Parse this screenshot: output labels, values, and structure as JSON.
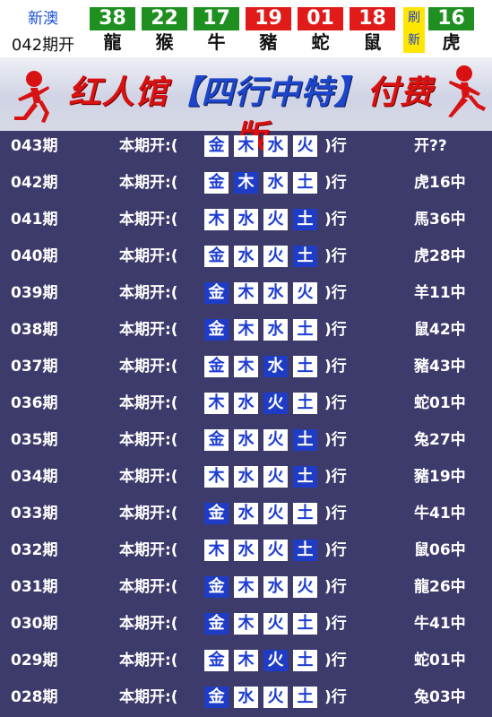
{
  "header": {
    "region": "新澳",
    "period": "042期开",
    "balls": [
      {
        "number": "38",
        "zodiac": "龍",
        "color": "green"
      },
      {
        "number": "22",
        "zodiac": "猴",
        "color": "green"
      },
      {
        "number": "17",
        "zodiac": "牛",
        "color": "green"
      },
      {
        "number": "19",
        "zodiac": "豬",
        "color": "red"
      },
      {
        "number": "01",
        "zodiac": "蛇",
        "color": "red"
      },
      {
        "number": "18",
        "zodiac": "鼠",
        "color": "red"
      }
    ],
    "refresh_label": "刷新",
    "special_ball": {
      "number": "16",
      "zodiac": "虎",
      "color": "green"
    }
  },
  "banner": {
    "title_a": "红人馆",
    "title_b": "【四行中特】",
    "title_c": "付费版"
  },
  "row_labels": {
    "prefix": "本期开:(",
    "suffix": ")行"
  },
  "rows": [
    {
      "issue": "043期",
      "elements": [
        "金",
        "木",
        "水",
        "火"
      ],
      "hit": -1,
      "result": "开??"
    },
    {
      "issue": "042期",
      "elements": [
        "金",
        "木",
        "水",
        "土"
      ],
      "hit": 1,
      "result": "虎16中"
    },
    {
      "issue": "041期",
      "elements": [
        "木",
        "水",
        "火",
        "土"
      ],
      "hit": 3,
      "result": "馬36中"
    },
    {
      "issue": "040期",
      "elements": [
        "金",
        "水",
        "火",
        "土"
      ],
      "hit": 3,
      "result": "虎28中"
    },
    {
      "issue": "039期",
      "elements": [
        "金",
        "木",
        "水",
        "火"
      ],
      "hit": 0,
      "result": "羊11中"
    },
    {
      "issue": "038期",
      "elements": [
        "金",
        "木",
        "水",
        "土"
      ],
      "hit": 0,
      "result": "鼠42中"
    },
    {
      "issue": "037期",
      "elements": [
        "金",
        "木",
        "水",
        "土"
      ],
      "hit": 2,
      "result": "豬43中"
    },
    {
      "issue": "036期",
      "elements": [
        "木",
        "水",
        "火",
        "土"
      ],
      "hit": 2,
      "result": "蛇01中"
    },
    {
      "issue": "035期",
      "elements": [
        "金",
        "水",
        "火",
        "土"
      ],
      "hit": 3,
      "result": "兔27中"
    },
    {
      "issue": "034期",
      "elements": [
        "木",
        "水",
        "火",
        "土"
      ],
      "hit": 3,
      "result": "豬19中"
    },
    {
      "issue": "033期",
      "elements": [
        "金",
        "水",
        "火",
        "土"
      ],
      "hit": 0,
      "result": "牛41中"
    },
    {
      "issue": "032期",
      "elements": [
        "木",
        "水",
        "火",
        "土"
      ],
      "hit": 3,
      "result": "鼠06中"
    },
    {
      "issue": "031期",
      "elements": [
        "金",
        "木",
        "水",
        "火"
      ],
      "hit": 0,
      "result": "龍26中"
    },
    {
      "issue": "030期",
      "elements": [
        "金",
        "木",
        "火",
        "土"
      ],
      "hit": 0,
      "result": "牛41中"
    },
    {
      "issue": "029期",
      "elements": [
        "金",
        "木",
        "火",
        "土"
      ],
      "hit": 2,
      "result": "蛇01中"
    },
    {
      "issue": "028期",
      "elements": [
        "金",
        "水",
        "火",
        "土"
      ],
      "hit": 0,
      "result": "兔03中"
    }
  ]
}
